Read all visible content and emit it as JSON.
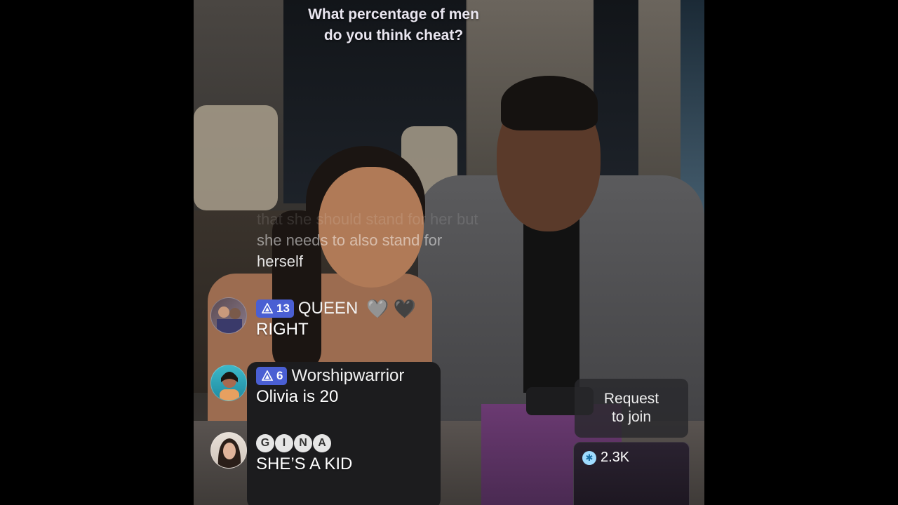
{
  "question": {
    "line1": "What percentage of men",
    "line2": "do you think cheat?"
  },
  "faded_comment": {
    "line0": "that she should stand for her but",
    "line1": "she needs to also stand for",
    "line2": "herself"
  },
  "comments": [
    {
      "level": "13",
      "username": "QUEEN",
      "hearts": [
        "🩶",
        "🖤"
      ],
      "text": "RIGHT",
      "avatar_icon": "user-avatar-photo"
    },
    {
      "level": "6",
      "username": "Worshipwarrior",
      "text": "Olivia is 20",
      "avatar_icon": "user-avatar-photo"
    },
    {
      "username_letters": [
        "G",
        "I",
        "N",
        "A"
      ],
      "text": "SHE’S A KID",
      "avatar_icon": "user-avatar-photo"
    }
  ],
  "request_join": {
    "line1": "Request",
    "line2": "to join"
  },
  "viewers": {
    "count": "2.3K",
    "icon": "viewer-count-icon"
  },
  "colors": {
    "badge": "#4a5fd3",
    "overlay_text": "#ffffff",
    "request_bg": "#28282c"
  }
}
